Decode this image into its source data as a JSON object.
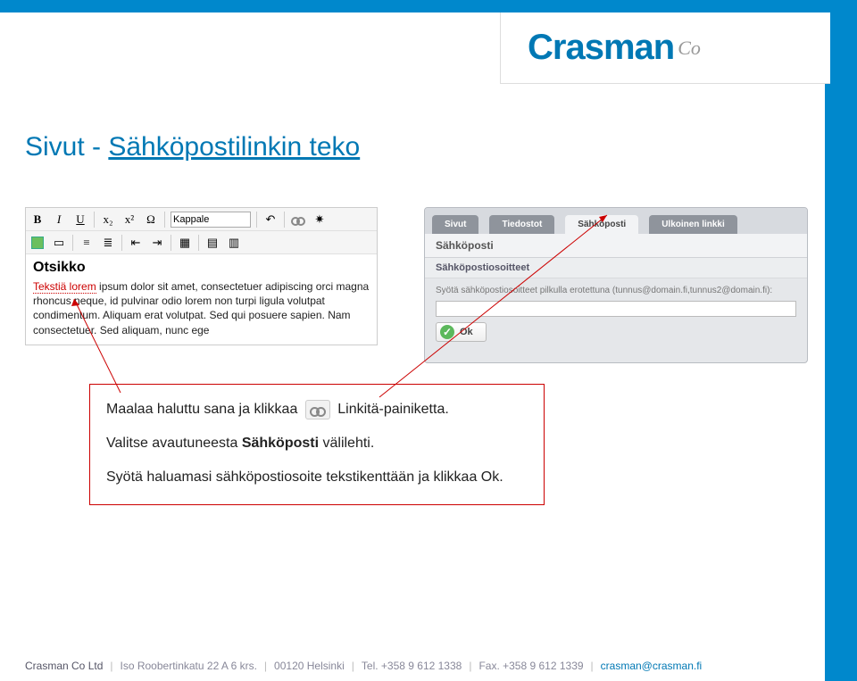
{
  "logo": {
    "main": "Crasman",
    "sub": "Co"
  },
  "title": {
    "prefix": "Sivut - ",
    "link": "Sähköpostilinkin teko"
  },
  "editor": {
    "toolbar": {
      "bold": "B",
      "italic": "I",
      "underline": "U",
      "sub": "x₂",
      "sup": "x²",
      "omega": "Ω",
      "style_select": "Kappale"
    },
    "heading": "Otsikko",
    "body_highlight": "Tekstiä lorem",
    "body_rest": " ipsum dolor sit amet, consectetuer adipiscing orci magna rhoncus neque, id pulvinar odio lorem non turpi ligula volutpat condimentum. Aliquam erat volutpat. Sed qui posuere sapien. Nam consectetuer. Sed aliquam, nunc ege"
  },
  "dialog": {
    "tabs": [
      "Sivut",
      "Tiedostot",
      "Sähköposti",
      "Ulkoinen linkki"
    ],
    "subheader": "Sähköposti",
    "section": "Sähköpostiosoitteet",
    "hint": "Syötä sähköpostiosoitteet pilkulla erotettuna (tunnus@domain.fi,tunnus2@domain.fi):",
    "ok": "Ok"
  },
  "instructions": {
    "line1a": "Maalaa haluttu sana ja klikkaa",
    "line1b": "Linkitä-painiketta.",
    "line2a": "Valitse avautuneesta ",
    "line2b": "Sähköposti",
    "line2c": " välilehti.",
    "line3": "Syötä haluamasi sähköpostiosoite tekstikenttään ja klikkaa Ok."
  },
  "footer": {
    "company": "Crasman Co Ltd",
    "address": "Iso Roobertinkatu 22 A 6 krs.",
    "postal": "00120 Helsinki",
    "tel": "Tel. +358 9 612 1338",
    "fax": "Fax. +358 9 612 1339",
    "email": "crasman@crasman.fi"
  }
}
